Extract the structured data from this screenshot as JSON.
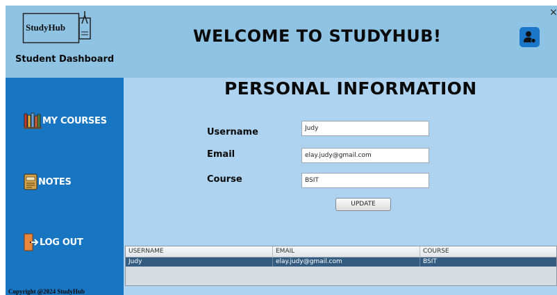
{
  "header": {
    "logo_text": "StudyHub",
    "subtitle": "Student Dashboard",
    "welcome": "WELCOME TO STUDYHUB!",
    "close_glyph": "×"
  },
  "sidebar": {
    "items": [
      {
        "label": "MY COURSES",
        "icon": "books-icon"
      },
      {
        "label": "NOTES",
        "icon": "notebook-icon"
      },
      {
        "label": "LOG OUT",
        "icon": "exit-door-icon"
      }
    ],
    "copyright": "Copyright @2024  StudyHub"
  },
  "main": {
    "title": "PERSONAL INFORMATION",
    "fields": [
      {
        "label": "Username",
        "value": "Judy"
      },
      {
        "label": "Email",
        "value": "elay.judy@gmail.com"
      },
      {
        "label": "Course",
        "value": "BSIT"
      }
    ],
    "update_label": "UPDATE"
  },
  "table": {
    "columns": [
      "USERNAME",
      "EMAIL",
      "COURSE"
    ],
    "rows": [
      [
        "Judy",
        "elay.judy@gmail.com",
        "BSIT"
      ]
    ]
  },
  "colors": {
    "header_bg": "#8fc3e4",
    "sidebar_bg": "#1875c2",
    "main_bg": "#aed3f0",
    "selected_row": "#345c80"
  }
}
